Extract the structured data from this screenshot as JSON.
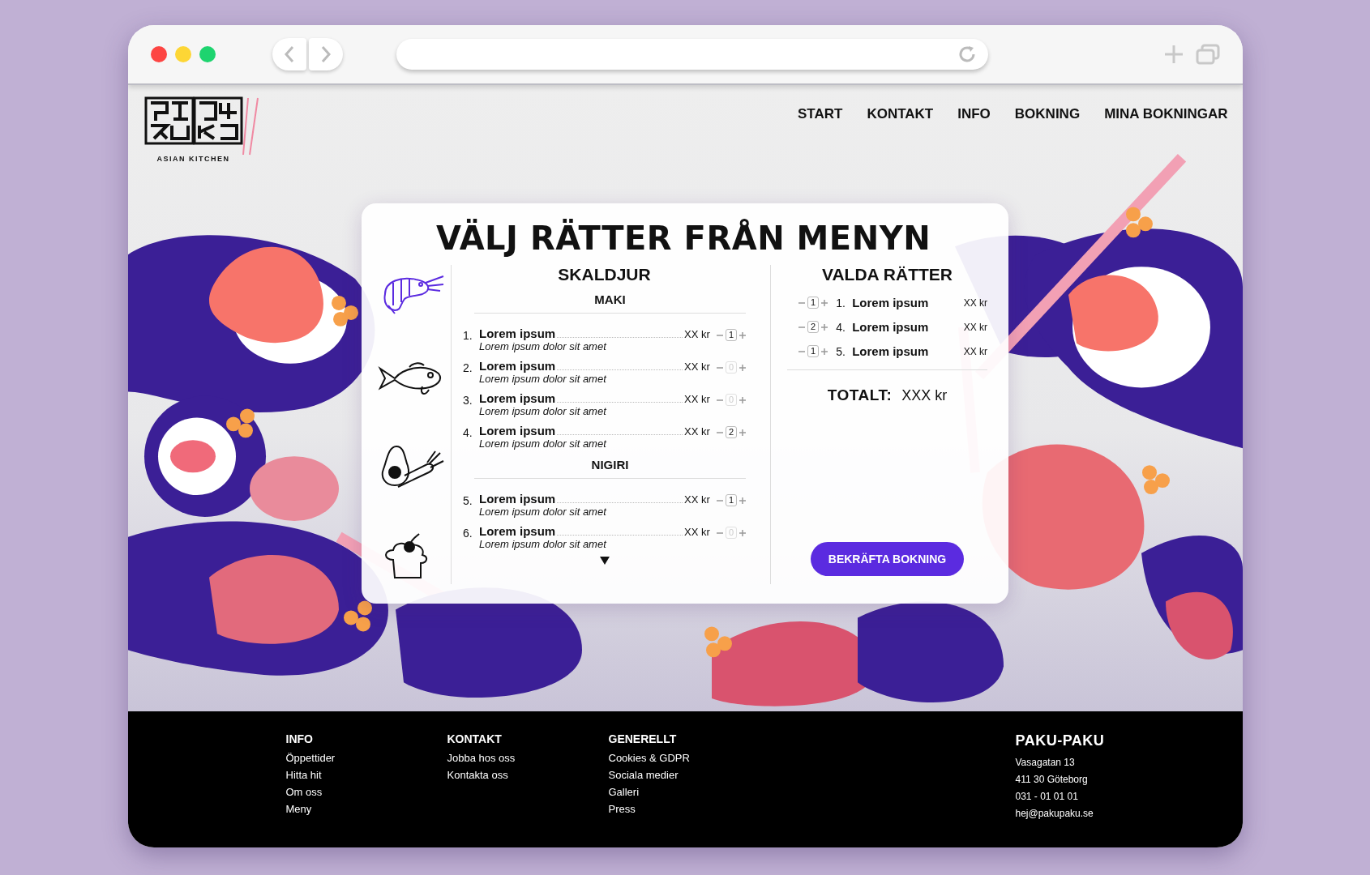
{
  "logo": {
    "tagline": "ASIAN KITCHEN"
  },
  "nav": [
    {
      "label": "START"
    },
    {
      "label": "KONTAKT"
    },
    {
      "label": "INFO"
    },
    {
      "label": "BOKNING"
    },
    {
      "label": "MINA BOKNINGAR"
    }
  ],
  "menu": {
    "title": "VÄLJ RÄTTER FRÅN MENYN",
    "categories": [
      {
        "kind": "shrimp",
        "selected": true
      },
      {
        "kind": "fish",
        "selected": false
      },
      {
        "kind": "vegetable",
        "selected": false
      },
      {
        "kind": "dessert",
        "selected": false
      }
    ],
    "category_title": "SKALDJUR",
    "sections": [
      {
        "heading": "MAKI",
        "items": [
          {
            "number": "1.",
            "name": "Lorem ipsum",
            "description": "Lorem ipsum dolor sit amet",
            "price": "XX kr",
            "quantity": "1",
            "selected": true
          },
          {
            "number": "2.",
            "name": "Lorem ipsum",
            "description": "Lorem ipsum dolor sit amet",
            "price": "XX kr",
            "quantity": "0",
            "selected": false
          },
          {
            "number": "3.",
            "name": "Lorem ipsum",
            "description": "Lorem ipsum dolor sit amet",
            "price": "XX kr",
            "quantity": "0",
            "selected": false
          },
          {
            "number": "4.",
            "name": "Lorem ipsum",
            "description": "Lorem ipsum dolor sit amet",
            "price": "XX kr",
            "quantity": "2",
            "selected": true
          }
        ]
      },
      {
        "heading": "NIGIRI",
        "items": [
          {
            "number": "5.",
            "name": "Lorem ipsum",
            "description": "Lorem ipsum dolor sit amet",
            "price": "XX kr",
            "quantity": "1",
            "selected": true
          },
          {
            "number": "6.",
            "name": "Lorem ipsum",
            "description": "Lorem ipsum dolor sit amet",
            "price": "XX kr",
            "quantity": "0",
            "selected": false
          }
        ]
      }
    ]
  },
  "order": {
    "title": "VALDA RÄTTER",
    "items": [
      {
        "quantity": "1",
        "number": "1.",
        "name": "Lorem ipsum",
        "price": "XX kr"
      },
      {
        "quantity": "2",
        "number": "4.",
        "name": "Lorem ipsum",
        "price": "XX kr"
      },
      {
        "quantity": "1",
        "number": "5.",
        "name": "Lorem ipsum",
        "price": "XX kr"
      }
    ],
    "total_label": "TOTALT:",
    "total_value": "XXX kr",
    "confirm_button": "BEKRÄFTA BOKNING"
  },
  "footer": {
    "columns": [
      {
        "heading": "INFO",
        "links": [
          "Öppettider",
          "Hitta hit",
          "Om oss",
          "Meny"
        ]
      },
      {
        "heading": "KONTAKT",
        "links": [
          "Jobba hos oss",
          "Kontakta oss"
        ]
      },
      {
        "heading": "GENERELLT",
        "links": [
          "Cookies & GDPR",
          "Sociala medier",
          "Galleri",
          "Press"
        ]
      }
    ],
    "contact": {
      "name": "PAKU-PAKU",
      "lines": [
        "Vasagatan 13",
        "411 30 Göteborg",
        "031 - 01 01 01",
        "hej@pakupaku.se"
      ]
    }
  }
}
